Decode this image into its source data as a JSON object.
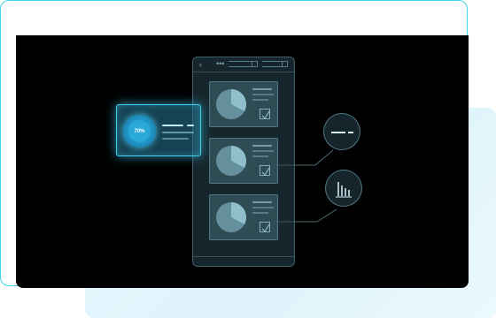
{
  "widget": {
    "gauge_label": "70%",
    "gauge_value": 70
  },
  "icons": {
    "menu": "ellipsis-icon",
    "back": "chevron-left-icon",
    "bubble_top": "text-lines-icon",
    "bubble_bottom": "bar-chart-icon"
  },
  "colors": {
    "accent": "#3fd4ea",
    "stage": "#000000",
    "panel": "#2b4650"
  }
}
